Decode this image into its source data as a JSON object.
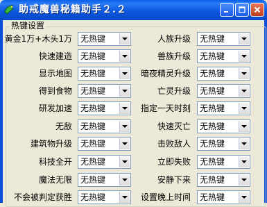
{
  "window": {
    "title": "助戒魔兽秘籍助手２.２"
  },
  "group": {
    "title": "热键设置"
  },
  "rows": [
    {
      "left_label": "黄金1万+木头1万",
      "left_value": "无热键",
      "right_label": "人族升级",
      "right_value": "无热键"
    },
    {
      "left_label": "快速建造",
      "left_value": "无热键",
      "right_label": "兽族升级",
      "right_value": "无热键"
    },
    {
      "left_label": "显示地图",
      "left_value": "无热键",
      "right_label": "暗夜精灵升级",
      "right_value": "无热键"
    },
    {
      "left_label": "得到食物",
      "left_value": "无热键",
      "right_label": "亡灵升级",
      "right_value": "无热键"
    },
    {
      "left_label": "研发加速",
      "left_value": "无热键",
      "right_label": "指定一天时刻",
      "right_value": "无热键"
    },
    {
      "left_label": "无敌",
      "left_value": "无热键",
      "right_label": "快速灭亡",
      "right_value": "无热键"
    },
    {
      "left_label": "建筑物升级",
      "left_value": "无热键",
      "right_label": "击败敌人",
      "right_value": "无热键"
    },
    {
      "left_label": "科技全开",
      "left_value": "无热键",
      "right_label": "立即失败",
      "right_value": "无热键"
    },
    {
      "left_label": "魔法无限",
      "left_value": "无热键",
      "right_label": "安静下来",
      "right_value": "无热键"
    },
    {
      "left_label": "不会被判定获胜",
      "left_value": "无热键",
      "right_label": "设置晚上时间",
      "right_value": "无热键"
    }
  ],
  "icons": {
    "app": "green-dragon-icon",
    "minimize": "minimize-icon",
    "maximize": "maximize-icon",
    "close": "close-icon",
    "dropdown": "chevron-down-icon"
  },
  "colors": {
    "titlebar": "#0a5fe8",
    "window_bg": "#ece9d8",
    "close_button": "#c13d1b",
    "combo_border": "#7f9db9"
  }
}
